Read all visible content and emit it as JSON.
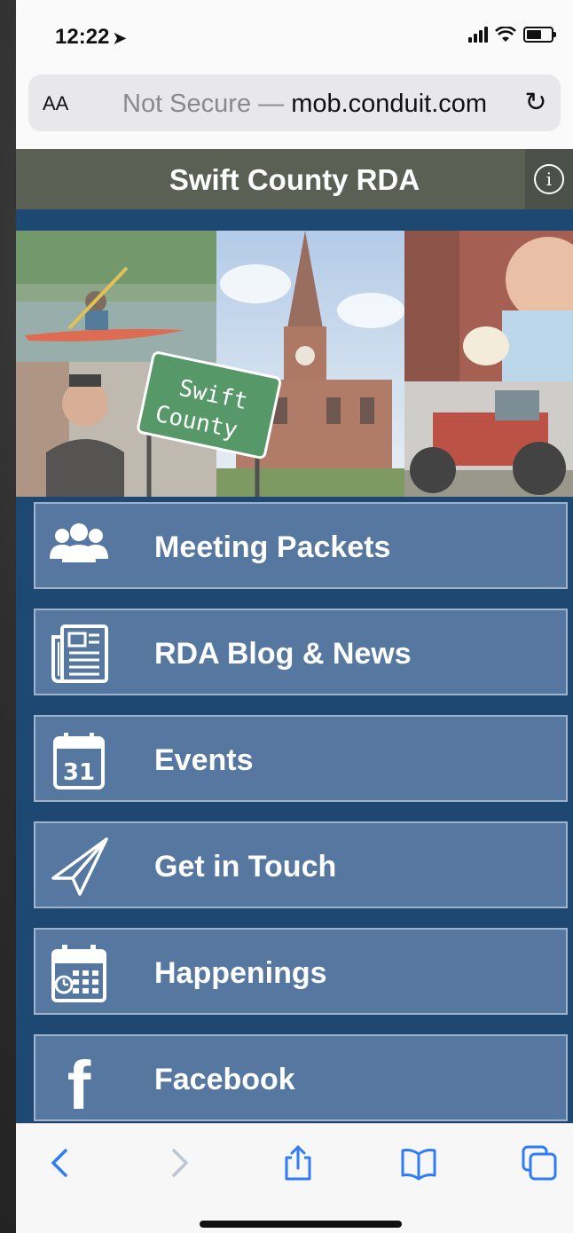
{
  "status_bar": {
    "time": "12:22"
  },
  "browser": {
    "text_size_button": "AA",
    "url_prefix": "Not Secure —",
    "url_domain": "mob.conduit.com"
  },
  "app": {
    "title": "Swift County RDA"
  },
  "hero": {
    "sign_line1": "Swift",
    "sign_line2": "County"
  },
  "menu": {
    "items": [
      {
        "label": "Meeting Packets",
        "icon": "people-group-icon"
      },
      {
        "label": "RDA Blog & News",
        "icon": "newspaper-icon"
      },
      {
        "label": "Events",
        "icon": "calendar-icon",
        "icon_text": "31"
      },
      {
        "label": "Get in Touch",
        "icon": "paper-plane-icon"
      },
      {
        "label": "Happenings",
        "icon": "calendar-grid-icon"
      },
      {
        "label": "Facebook",
        "icon": "facebook-icon",
        "icon_text": "f"
      }
    ]
  },
  "colors": {
    "page_bg": "#1c4872",
    "menu_button": "#5678a0",
    "header_bar": "#5b6054",
    "toolbar_accent": "#2f7cf6"
  }
}
